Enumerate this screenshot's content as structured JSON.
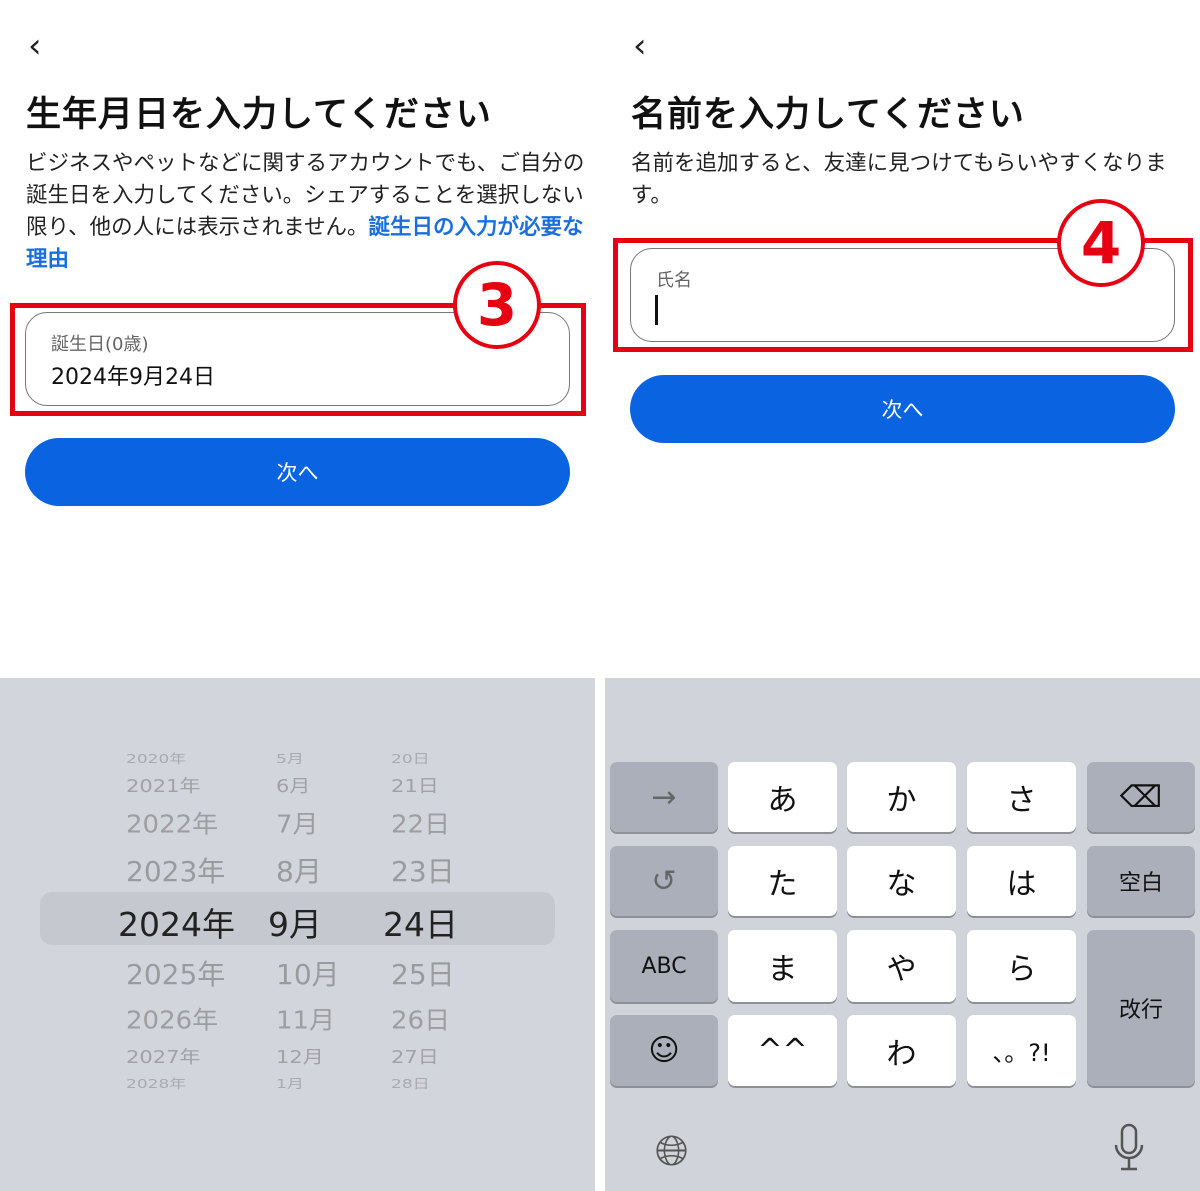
{
  "left_screen": {
    "back_icon": "chevron-left-icon",
    "title": "生年月日を入力してください",
    "description": "ビジネスやペットなどに関するアカウントでも、ご自分の誕生日を入力してください。シェアすることを選択しない限り、他の人には表示されません。",
    "link": "誕生日の入力が必要な理由",
    "field_label": "誕生日(0歳)",
    "field_value": "2024年9月24日",
    "step_badge": "3",
    "next_button": "次へ",
    "picker": {
      "years": [
        "2020年",
        "2021年",
        "2022年",
        "2023年",
        "2024年",
        "2025年",
        "2026年",
        "2027年",
        "2028年"
      ],
      "months": [
        "5月",
        "6月",
        "7月",
        "8月",
        "9月",
        "10月",
        "11月",
        "12月",
        "1月"
      ],
      "days": [
        "20日",
        "21日",
        "22日",
        "23日",
        "24日",
        "25日",
        "26日",
        "27日",
        "28日"
      ],
      "selected": {
        "year": "2024年",
        "month": "9月",
        "day": "24日"
      }
    }
  },
  "right_screen": {
    "back_icon": "chevron-left-icon",
    "title": "名前を入力してください",
    "description": "名前を追加すると、友達に見つけてもらいやすくなります。",
    "field_label": "氏名",
    "field_value": "",
    "step_badge": "4",
    "next_button": "次へ",
    "keyboard": {
      "next_key": "→",
      "undo_icon": "undo-icon",
      "abc": "ABC",
      "emoji_icon": "emoji-icon",
      "kana": [
        "あ",
        "か",
        "さ",
        "た",
        "な",
        "は",
        "ま",
        "や",
        "ら",
        "^^",
        "わ",
        "、。?!"
      ],
      "delete_icon": "delete-icon",
      "space": "空白",
      "return": "改行",
      "globe_icon": "globe-icon",
      "mic_icon": "microphone-icon"
    }
  },
  "colors": {
    "accent": "#0a63e0",
    "highlight": "#e60012"
  }
}
